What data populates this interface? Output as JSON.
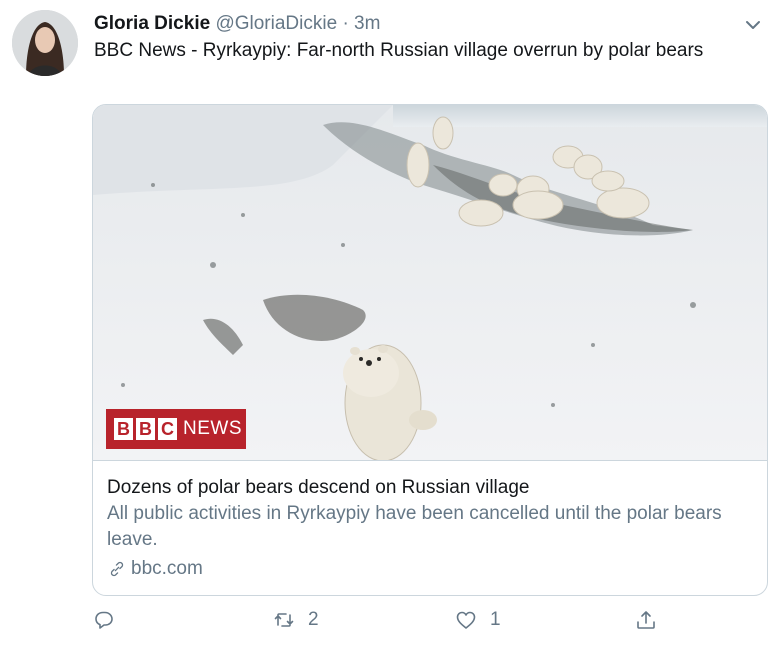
{
  "tweet": {
    "display_name": "Gloria Dickie",
    "handle": "@GloriaDickie",
    "separator": "·",
    "time": "3m",
    "text": "BBC News - Ryrkaypiy: Far-north Russian village overrun by polar bears"
  },
  "card": {
    "logo_letters": [
      "B",
      "B",
      "C"
    ],
    "logo_news": "NEWS",
    "title": "Dozens of polar bears descend on Russian village",
    "description": "All public activities in Ryrkaypiy have been cancelled until the polar bears leave.",
    "domain": "bbc.com"
  },
  "actions": {
    "reply_icon": "reply-icon",
    "retweet_icon": "retweet-icon",
    "retweet_count": "2",
    "like_icon": "heart-icon",
    "like_count": "1",
    "share_icon": "share-icon"
  },
  "colors": {
    "text": "#14171a",
    "secondary": "#657786",
    "border": "#ccd6dd",
    "bbc_red": "#b8232b"
  }
}
